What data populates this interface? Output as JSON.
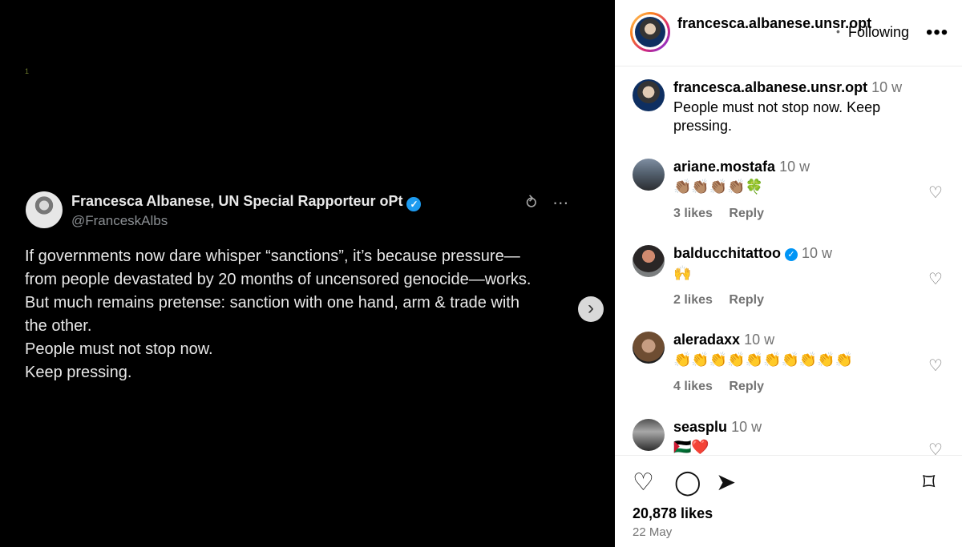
{
  "media": {
    "tweet_mark": "1",
    "tweet": {
      "name": "Francesca Albanese, UN Special Rapporteur oPt",
      "handle": "@FranceskAlbs",
      "lines": [
        "If governments now dare whisper “sanctions”, it’s because pressure—",
        "from people devastated by 20 months of uncensored genocide—works.",
        "But much remains pretense: sanction with one hand, arm & trade with",
        "the other.",
        "People must not stop now.",
        "Keep pressing."
      ],
      "icons": [
        "recycle-icon",
        "ellipsis-icon"
      ]
    }
  },
  "header": {
    "username": "francesca.albanese.unsr.opt",
    "follow_dot": "•",
    "following": "Following",
    "more": "•••"
  },
  "comments": [
    {
      "username": "francesca.albanese.unsr.opt",
      "time": "10 w",
      "text": "People must not stop now. Keep pressing.",
      "likes": "",
      "reply": ""
    },
    {
      "username": "ariane.mostafa",
      "time": "10 w",
      "text": "👏🏽👏🏽👏🏽👏🏽🍀",
      "likes": "3 likes",
      "reply": "Reply"
    },
    {
      "username": "balducchitattoo",
      "time": "10 w",
      "text": "🙌",
      "likes": "2 likes",
      "reply": "Reply",
      "verified": "✓"
    },
    {
      "username": "aleradaxx",
      "time": "10 w",
      "text": "👏👏👏👏👏👏👏👏👏👏",
      "likes": "4 likes",
      "reply": "Reply"
    },
    {
      "username": "seasplu",
      "time": "10 w",
      "text": "🇵🇸❤️",
      "likes": "",
      "reply": ""
    }
  ],
  "footer": {
    "likes": "20,878 likes",
    "date": "22 May"
  },
  "icons": {
    "like": "heart-icon",
    "comment": "comment-icon",
    "share": "share-icon",
    "save": "bookmark-icon",
    "next": "chevron-right-icon"
  },
  "colors": {
    "accent_blue": "#0095f6",
    "ring_start": "#feda75",
    "ring_end": "#4f5bd5"
  }
}
